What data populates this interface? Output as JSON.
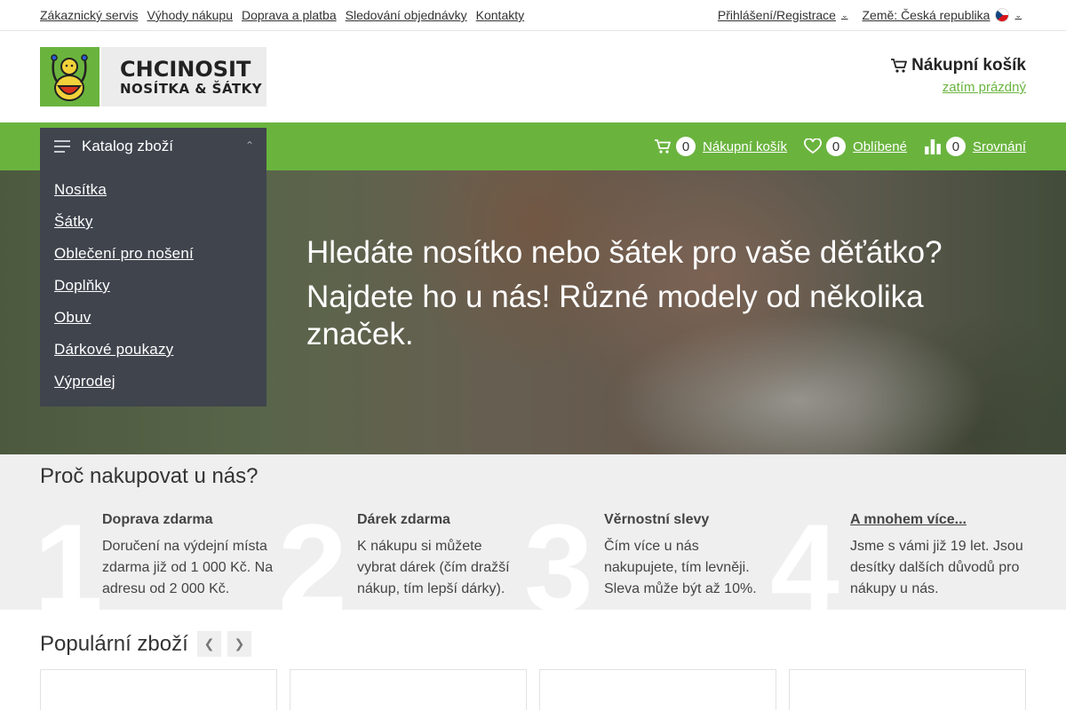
{
  "topbar": {
    "links": [
      "Zákaznický servis",
      "Výhody nákupu",
      "Doprava a platba",
      "Sledování objednávky",
      "Kontakty"
    ],
    "login": "Přihlášení/Registrace",
    "country": "Země: Česká republika"
  },
  "logo": {
    "line1": "CHCINOSIT",
    "line2": "NOSÍTKA & ŠÁTKY"
  },
  "cart_header": {
    "title": "Nákupní košík",
    "status": "zatím prázdný"
  },
  "nav": {
    "cart": {
      "count": "0",
      "label": "Nákupní košík"
    },
    "favorites": {
      "count": "0",
      "label": "Oblíbené"
    },
    "compare": {
      "count": "0",
      "label": "Srovnání"
    }
  },
  "catalog": {
    "title": "Katalog zboží",
    "items": [
      "Nosítka",
      "Šátky",
      "Oblečení pro nošení",
      "Doplňky",
      "Obuv",
      "Dárkové poukazy",
      "Výprodej"
    ]
  },
  "hero": {
    "line1": "Hledáte nosítko nebo šátek pro vaše děťátko?",
    "line2": "Najdete ho u nás! Různé modely od několika značek."
  },
  "why": {
    "title": "Proč nakupovat u nás?",
    "items": [
      {
        "num": "1",
        "title": "Doprava zdarma",
        "text": "Doručení na výdejní místa zdarma již od 1 000 Kč. Na adresu od 2 000 Kč."
      },
      {
        "num": "2",
        "title": "Dárek zdarma",
        "text": "K nákupu si můžete vybrat dárek (čím dražší nákup, tím lepší dárky)."
      },
      {
        "num": "3",
        "title": "Věrnostní slevy",
        "text": "Čím více u nás nakupujete, tím levněji. Sleva může být až 10%."
      },
      {
        "num": "4",
        "title": "A mnohem více...",
        "text": "Jsme s vámi již 19 let. Jsou desítky dalších důvodů pro nákupy u nás."
      }
    ]
  },
  "popular": {
    "title": "Populární zboží"
  },
  "colors": {
    "brand_green": "#6ab43e",
    "catalog_bg": "#3f444d"
  }
}
